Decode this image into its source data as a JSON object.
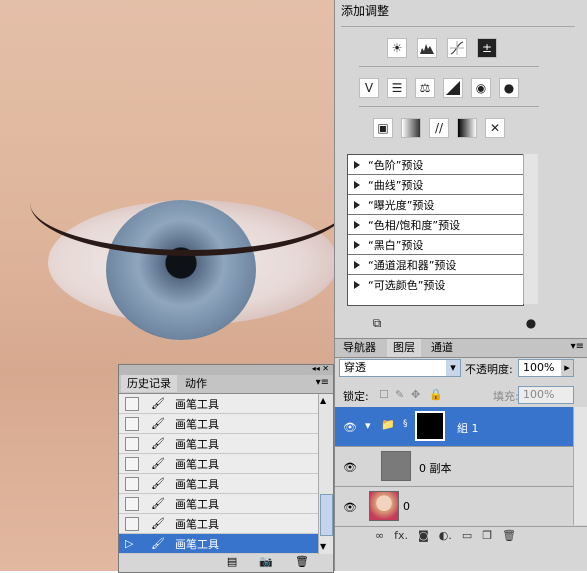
{
  "adjustments": {
    "title": "添加调整",
    "icons_row1": [
      "brightness-contrast-icon",
      "levels-icon",
      "curves-icon",
      "exposure-icon"
    ],
    "icons_row2": [
      "vibrance-icon",
      "hue-saturation-icon",
      "color-balance-icon",
      "black-white-icon",
      "photo-filter-icon",
      "channel-mixer-icon"
    ],
    "icons_row3": [
      "invert-icon",
      "posterize-icon",
      "threshold-icon",
      "gradient-map-icon",
      "selective-color-icon"
    ],
    "presets": [
      "“色阶”预设",
      "“曲线”预设",
      "“曝光度”预设",
      "“色相/饱和度”预设",
      "“黑白”预设",
      "“通道混和器”预设",
      "“可选颜色”预设"
    ]
  },
  "layers": {
    "tabs": [
      "导航器",
      "图层",
      "通道"
    ],
    "active_tab": "图层",
    "blend_mode": "穿透",
    "opacity_label": "不透明度:",
    "opacity_value": "100%",
    "lock_label": "锁定:",
    "fill_label": "填充:",
    "fill_value": "100%",
    "items": [
      {
        "name": "組 1",
        "selected": true
      },
      {
        "name": "0 副本",
        "selected": false
      },
      {
        "name": "0",
        "selected": false
      }
    ]
  },
  "history": {
    "tabs": [
      "历史记录",
      "动作"
    ],
    "active_tab": "历史记录",
    "rows": [
      "画笔工具",
      "画笔工具",
      "画笔工具",
      "画笔工具",
      "画笔工具",
      "画笔工具",
      "画笔工具",
      "画笔工具"
    ],
    "selected_index": 7
  },
  "colors": {
    "selection": "#3873cc",
    "panel": "#d6d6d6"
  }
}
